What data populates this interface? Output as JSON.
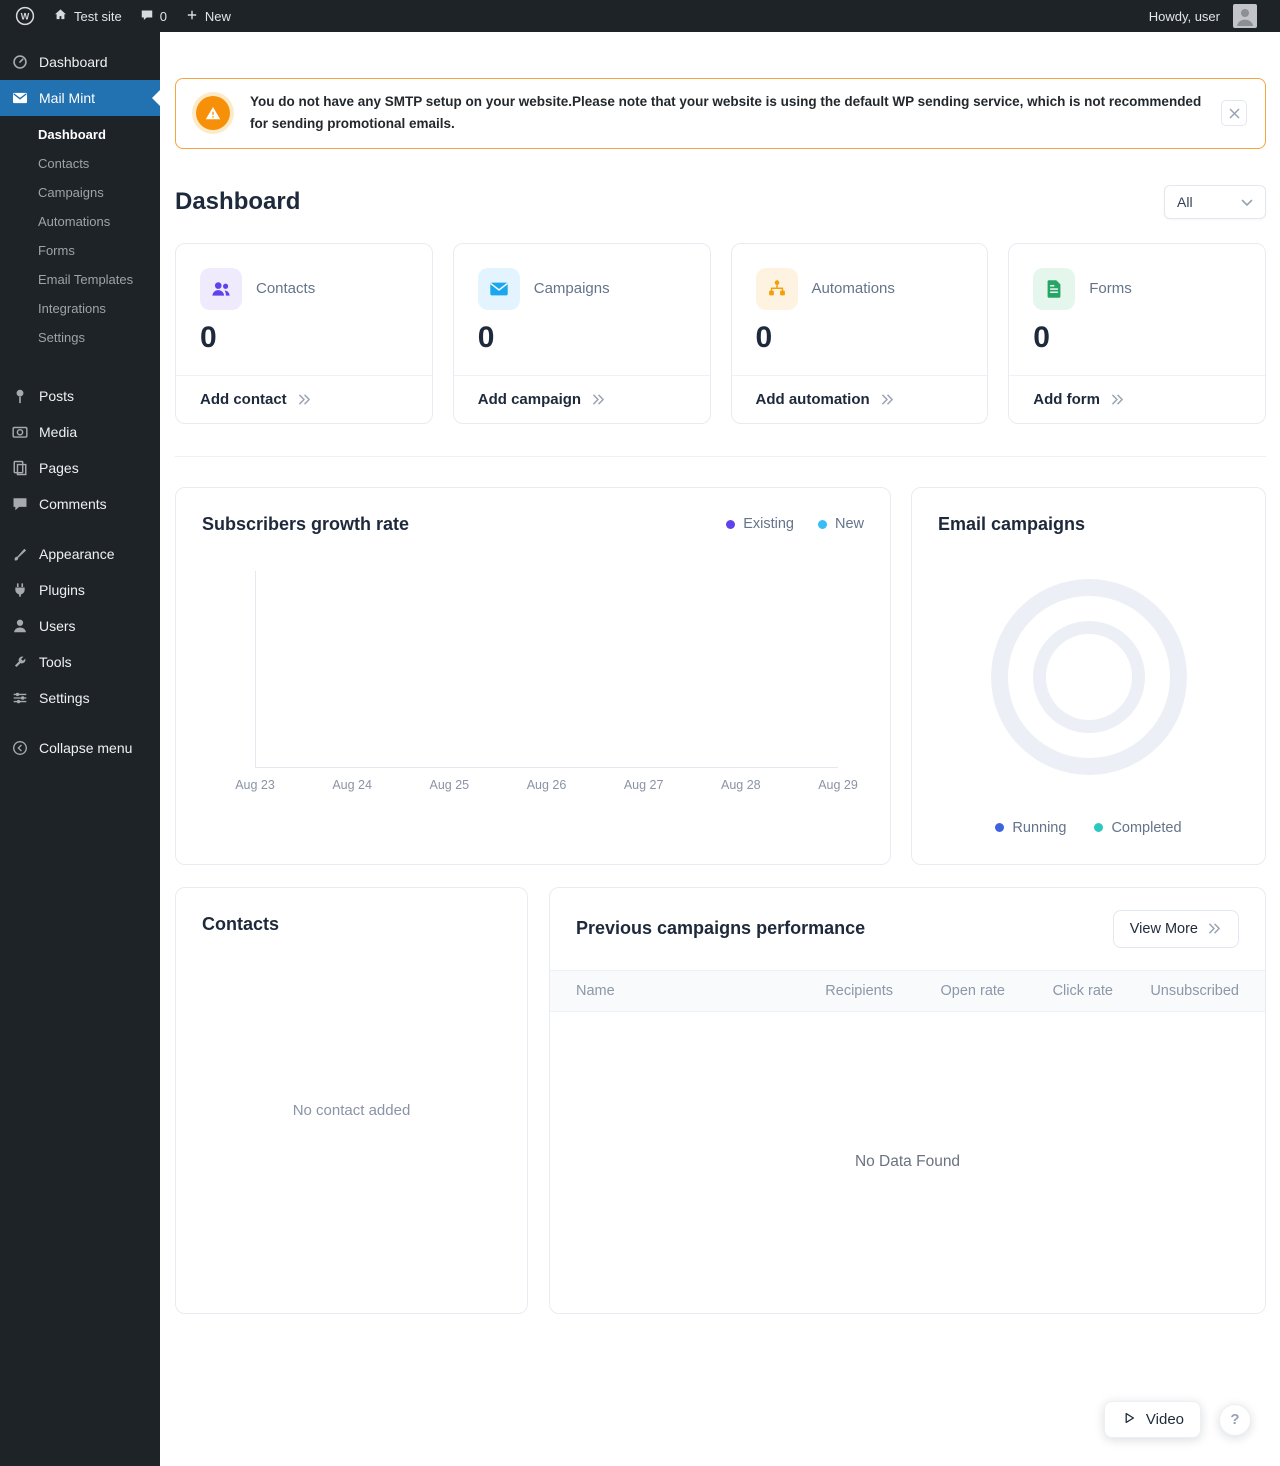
{
  "admin_bar": {
    "site_name": "Test site",
    "comments_count": "0",
    "new_label": "New",
    "howdy": "Howdy, user"
  },
  "sidebar": {
    "dashboard": "Dashboard",
    "mail_mint": "Mail Mint",
    "mail_mint_submenu": [
      "Dashboard",
      "Contacts",
      "Campaigns",
      "Automations",
      "Forms",
      "Email Templates",
      "Integrations",
      "Settings"
    ],
    "content_group": [
      "Posts",
      "Media",
      "Pages",
      "Comments"
    ],
    "admin_group": [
      "Appearance",
      "Plugins",
      "Users",
      "Tools",
      "Settings"
    ],
    "collapse": "Collapse menu"
  },
  "notice": {
    "text": "You do not have any SMTP setup on your website.Please note that your website is using the default WP sending service, which is not recommended for sending promotional emails.",
    "accent": "#F3A63F"
  },
  "page": {
    "title": "Dashboard",
    "filter_value": "All"
  },
  "stats": [
    {
      "label": "Contacts",
      "value": "0",
      "action": "Add contact",
      "color": "#6042EC",
      "bg": "#EFEBFD"
    },
    {
      "label": "Campaigns",
      "value": "0",
      "action": "Add campaign",
      "color": "#1BA7F0",
      "bg": "#E3F4FE"
    },
    {
      "label": "Automations",
      "value": "0",
      "action": "Add automation",
      "color": "#F59E0B",
      "bg": "#FEF3E0"
    },
    {
      "label": "Forms",
      "value": "0",
      "action": "Add form",
      "color": "#27A567",
      "bg": "#E5F6EC"
    }
  ],
  "growth_chart": {
    "title": "Subscribers growth rate",
    "legend": [
      {
        "label": "Existing",
        "color": "#6042EC"
      },
      {
        "label": "New",
        "color": "#38BDF8"
      }
    ],
    "x_labels": [
      "Aug 23",
      "Aug 24",
      "Aug 25",
      "Aug 26",
      "Aug 27",
      "Aug 28",
      "Aug 29"
    ]
  },
  "email_campaigns": {
    "title": "Email campaigns",
    "legend": [
      {
        "label": "Running",
        "color": "#3E63DD"
      },
      {
        "label": "Completed",
        "color": "#2BC8C0"
      }
    ]
  },
  "contacts_card": {
    "title": "Contacts",
    "empty_text": "No contact added"
  },
  "campaigns_table": {
    "title": "Previous campaigns performance",
    "view_more": "View More",
    "columns": [
      "Name",
      "Recipients",
      "Open rate",
      "Click rate",
      "Unsubscribed"
    ],
    "empty_text": "No Data Found"
  },
  "floating": {
    "video": "Video",
    "help": "?"
  }
}
